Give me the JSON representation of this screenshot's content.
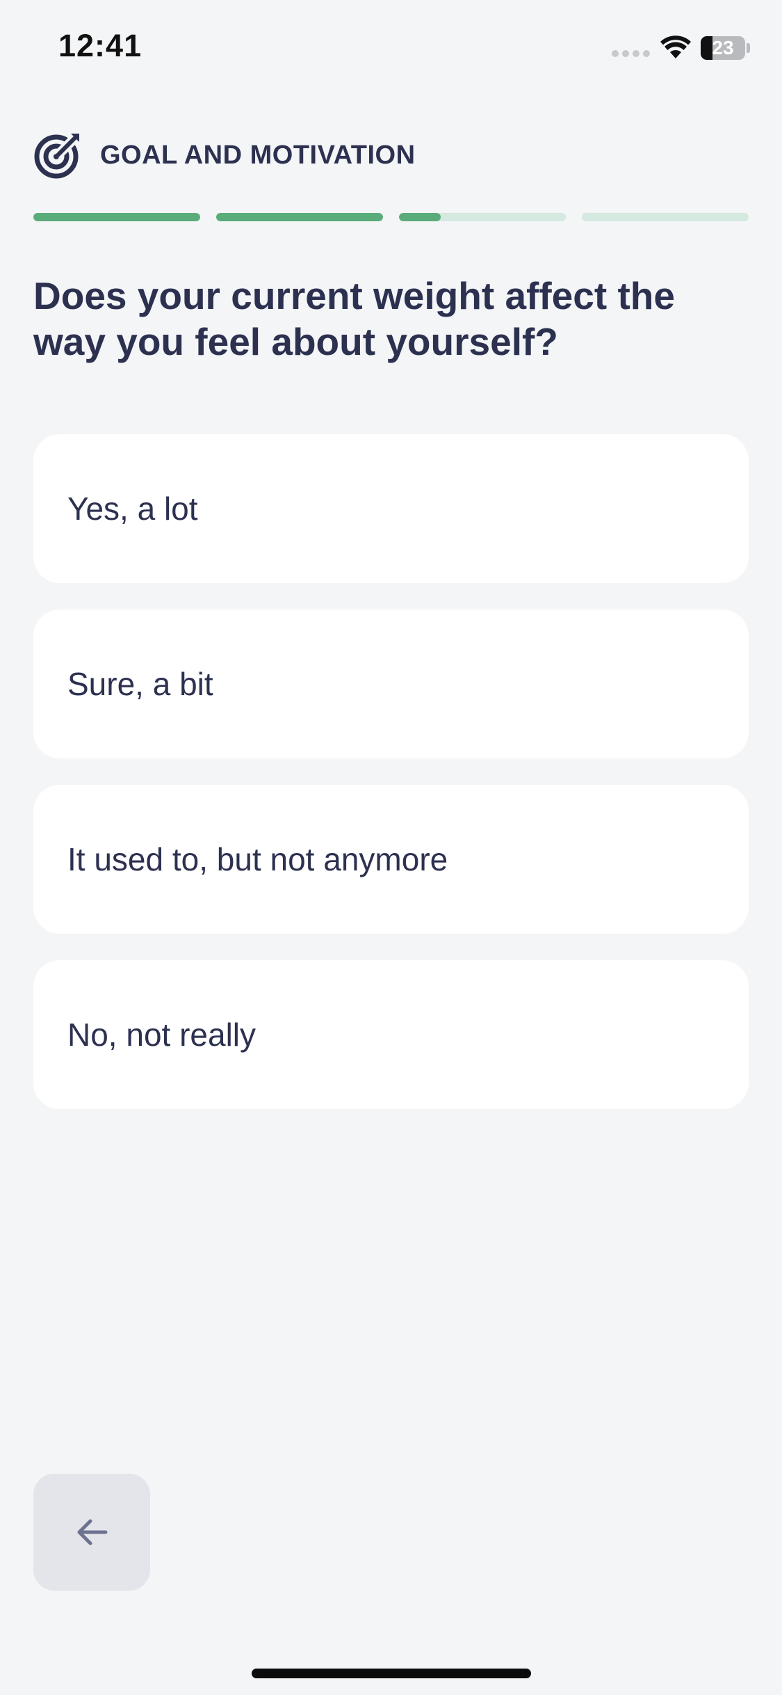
{
  "status_bar": {
    "time": "12:41",
    "battery": "23"
  },
  "header": {
    "icon": "target-icon",
    "title": "GOAL AND MOTIVATION"
  },
  "progress": {
    "segments": [
      1.0,
      1.0,
      0.25,
      0.0
    ],
    "fill_color": "#5aac7a",
    "track_color": "#d4e9df"
  },
  "question": "Does your current weight affect the way you feel about yourself?",
  "options": [
    {
      "label": "Yes, a lot"
    },
    {
      "label": "Sure, a bit"
    },
    {
      "label": "It used to, but not anymore"
    },
    {
      "label": "No, not really"
    }
  ],
  "navigation": {
    "back_icon": "arrow-left-icon"
  }
}
